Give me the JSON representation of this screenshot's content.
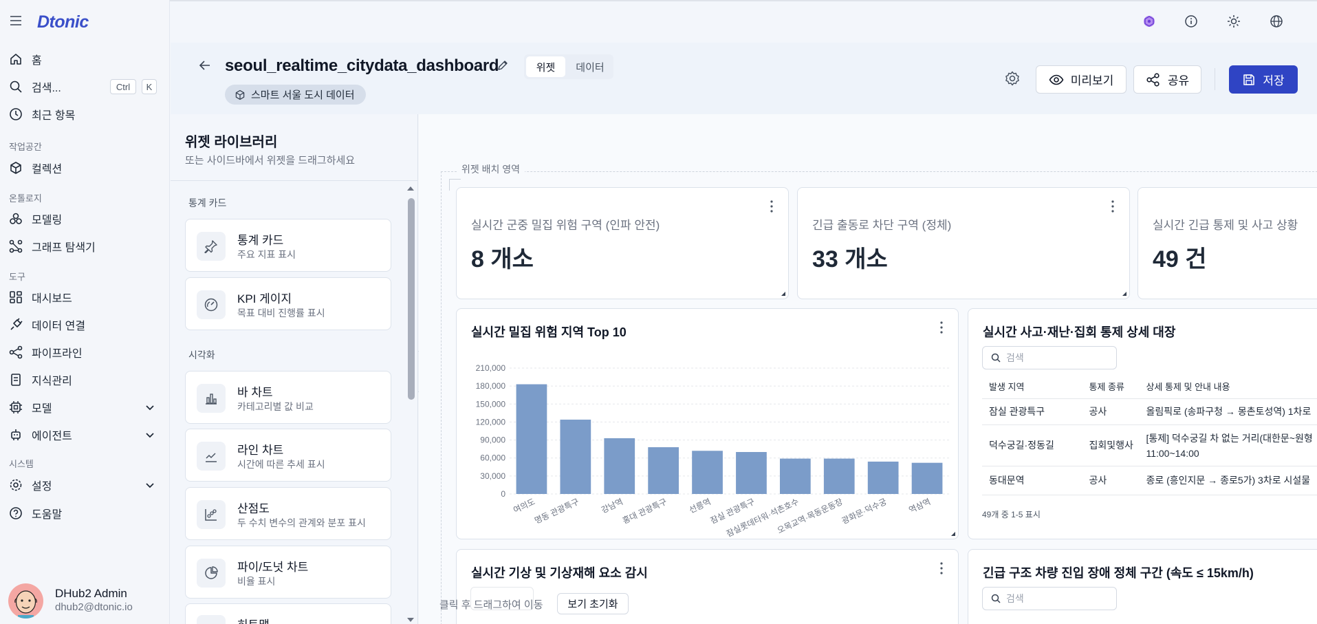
{
  "app": {
    "logo": "Dtonic"
  },
  "nav": {
    "home": "홈",
    "search": "검색...",
    "search_kbd_ctrl": "Ctrl",
    "search_kbd_key": "K",
    "recent": "최근 항목",
    "sec_workspace": "작업공간",
    "collections": "컬렉션",
    "sec_ontology": "온톨로지",
    "modeling": "모델링",
    "graph_explorer": "그래프 탐색기",
    "sec_tools": "도구",
    "dashboard": "대시보드",
    "data_connection": "데이터 연결",
    "pipeline": "파이프라인",
    "knowledge": "지식관리",
    "model": "모델",
    "agent": "에이전트",
    "sec_system": "시스템",
    "settings": "설정",
    "help": "도움말"
  },
  "user": {
    "name": "DHub2 Admin",
    "email": "dhub2@dtonic.io"
  },
  "header": {
    "title": "seoul_realtime_citydata_dashboard",
    "tab_widget": "위젯",
    "tab_data": "데이터",
    "dataset_chip": "스마트 서울 도시 데이터",
    "preview": "미리보기",
    "share": "공유",
    "save": "저장"
  },
  "library": {
    "title": "위젯 라이브러리",
    "subtitle": "또는 사이드바에서 위젯을 드래그하세요",
    "sec_stat": "통계 카드",
    "sec_viz": "시각화",
    "items": [
      {
        "title": "통계 카드",
        "desc": "주요 지표 표시"
      },
      {
        "title": "KPI 게이지",
        "desc": "목표 대비 진행률 표시"
      },
      {
        "title": "바 차트",
        "desc": "카테고리별 값 비교"
      },
      {
        "title": "라인 차트",
        "desc": "시간에 따른 추세 표시"
      },
      {
        "title": "산점도",
        "desc": "두 수치 변수의 관계와 분포 표시"
      },
      {
        "title": "파이/도넛 차트",
        "desc": "비율 표시"
      },
      {
        "title": "히트맵",
        "desc": ""
      }
    ]
  },
  "canvas": {
    "drop_label": "위젯 배치 영역",
    "hint": "클릭 후 드래그하여 이동",
    "reset": "보기 초기화"
  },
  "stats": [
    {
      "label": "실시간 군중 밀집 위험 구역 (인파 안전)",
      "value": "8 개소"
    },
    {
      "label": "긴급 출동로 차단 구역 (정체)",
      "value": "33 개소"
    },
    {
      "label": "실시간 긴급 통제 및 사고 상황",
      "value": "49 건"
    }
  ],
  "chart_data": {
    "type": "bar",
    "title": "실시간 밀집 위험 지역 Top 10",
    "categories": [
      "여의도",
      "명동 관광특구",
      "강남역",
      "홍대 관광특구",
      "선릉역",
      "잠실 관광특구",
      "잠실롯데타워·석촌호수",
      "오목교역·목동운동장",
      "광화문·덕수궁",
      "역삼역"
    ],
    "values": [
      183000,
      124000,
      93000,
      78000,
      72000,
      70000,
      59000,
      59000,
      54000,
      52000
    ],
    "ylim": [
      0,
      210000
    ],
    "yticks": [
      "210,000",
      "180,000",
      "150,000",
      "120,000",
      "90,000",
      "60,000",
      "30,000",
      "0"
    ],
    "grid": true,
    "color": "#7b9cc9"
  },
  "table_widget": {
    "title": "실시간 사고·재난·집회 통제 상세 대장",
    "search_placeholder": "검색",
    "columns": [
      "발생 지역",
      "통제 종류",
      "상세 통제 및 안내 내용"
    ],
    "rows": [
      {
        "area": "잠실 관광특구",
        "type": "공사",
        "detail": "올림픽로 (송파구청 → 몽촌토성역) 1차로"
      },
      {
        "area": "덕수궁길·정동길",
        "type": "집회및행사",
        "detail": "[통제] 덕수궁길 차 없는 거리(대한문~원형",
        "detail2": "11:00~14:00"
      },
      {
        "area": "동대문역",
        "type": "공사",
        "detail": "종로 (흥인지문 → 종로5가) 3차로 시설물"
      }
    ],
    "footer": "49개 중 1-5 표시"
  },
  "weather_widget": {
    "title": "실시간 기상 및 기상재해 요소 감시"
  },
  "traffic_widget": {
    "title": "긴급 구조 차량 진입 장애 정체 구간 (속도 ≤ 15km/h)",
    "search_placeholder": "검색"
  },
  "colors": {
    "primary": "#2f44c4",
    "bar": "#7b9cc9",
    "logo": "#3a4fc9"
  }
}
